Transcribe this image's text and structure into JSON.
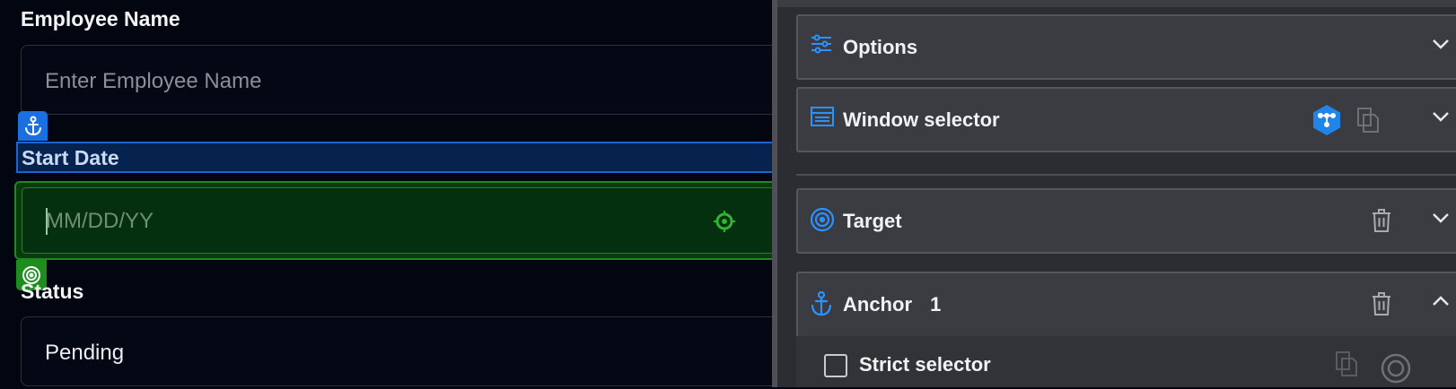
{
  "form": {
    "employee_name": {
      "label": "Employee Name",
      "placeholder": "Enter Employee Name"
    },
    "start_date": {
      "label": "Start Date",
      "placeholder": "MM/DD/YY"
    },
    "status": {
      "label": "Status",
      "value": "Pending"
    }
  },
  "panel": {
    "options": {
      "title": "Options",
      "icon": "sliders-icon"
    },
    "window_selector": {
      "title": "Window selector",
      "icon": "window-icon"
    },
    "target": {
      "title": "Target",
      "icon": "target-icon"
    },
    "anchor": {
      "title": "Anchor",
      "count": "1",
      "icon": "anchor-icon"
    },
    "strict_selector": {
      "label": "Strict selector",
      "checked": false
    }
  },
  "colors": {
    "accent": "#1e8fff",
    "anchor_highlight": "#1b6fe0",
    "target_highlight": "#1d8d1d"
  }
}
